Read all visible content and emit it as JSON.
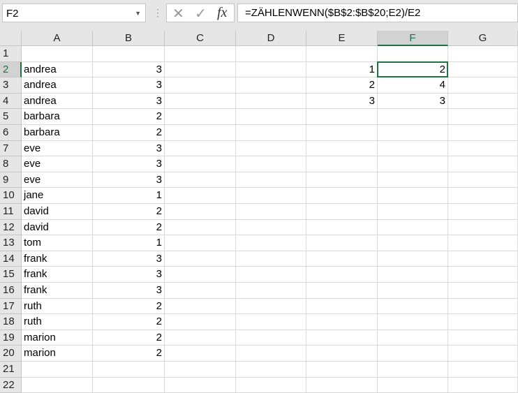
{
  "name_box": "F2",
  "formula": "=ZÄHLENWENN($B$2:$B$20;E2)/E2",
  "columns": [
    "A",
    "B",
    "C",
    "D",
    "E",
    "F",
    "G"
  ],
  "selected_column": "F",
  "selected_row": 2,
  "rows": [
    {
      "n": "1",
      "A": "",
      "B": "",
      "E": "",
      "F": ""
    },
    {
      "n": "2",
      "A": "andrea",
      "B": "3",
      "E": "1",
      "F": "2"
    },
    {
      "n": "3",
      "A": "andrea",
      "B": "3",
      "E": "2",
      "F": "4"
    },
    {
      "n": "4",
      "A": "andrea",
      "B": "3",
      "E": "3",
      "F": "3"
    },
    {
      "n": "5",
      "A": "barbara",
      "B": "2"
    },
    {
      "n": "6",
      "A": "barbara",
      "B": "2"
    },
    {
      "n": "7",
      "A": "eve",
      "B": "3"
    },
    {
      "n": "8",
      "A": "eve",
      "B": "3"
    },
    {
      "n": "9",
      "A": "eve",
      "B": "3"
    },
    {
      "n": "10",
      "A": "jane",
      "B": "1"
    },
    {
      "n": "11",
      "A": "david",
      "B": "2"
    },
    {
      "n": "12",
      "A": "david",
      "B": "2"
    },
    {
      "n": "13",
      "A": "tom",
      "B": "1"
    },
    {
      "n": "14",
      "A": "frank",
      "B": "3"
    },
    {
      "n": "15",
      "A": "frank",
      "B": "3"
    },
    {
      "n": "16",
      "A": "frank",
      "B": "3"
    },
    {
      "n": "17",
      "A": "ruth",
      "B": "2"
    },
    {
      "n": "18",
      "A": "ruth",
      "B": "2"
    },
    {
      "n": "19",
      "A": "marion",
      "B": "2"
    },
    {
      "n": "20",
      "A": "marion",
      "B": "2"
    },
    {
      "n": "21"
    },
    {
      "n": "22"
    }
  ]
}
